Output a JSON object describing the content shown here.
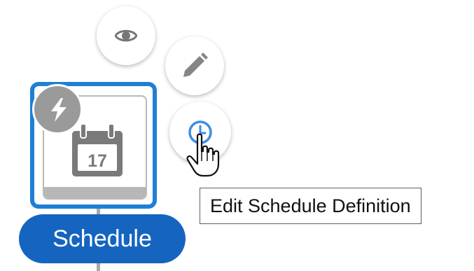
{
  "node": {
    "label": "Schedule",
    "calendar_day": "17",
    "icon": "calendar-icon",
    "trigger_icon": "lightning-icon"
  },
  "actions": {
    "view_icon": "eye-icon",
    "edit_icon": "pencil-icon",
    "schedule_icon": "clock-icon"
  },
  "tooltip": {
    "text": "Edit Schedule Definition"
  },
  "colors": {
    "accent": "#1e7fd6",
    "pill": "#1565c0",
    "icon_gray": "#8a8a8a",
    "clock_blue": "#3a8ee6"
  }
}
